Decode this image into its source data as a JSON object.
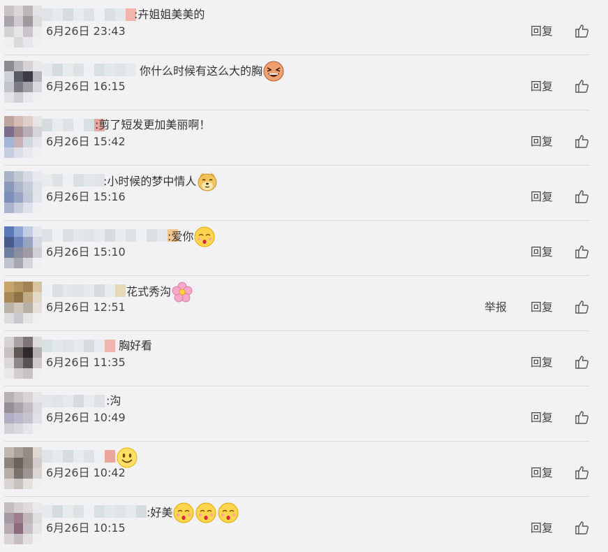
{
  "actions": {
    "reply_label": "回复",
    "report_label": "举报"
  },
  "comments": [
    {
      "prefix": ": ",
      "text": "卉姐姐美美的",
      "time": "6月26日 23:43",
      "emojis": []
    },
    {
      "prefix": "",
      "text": "你什么时候有这么大的胸",
      "time": "6月26日 16:15",
      "emojis": [
        "laughing-face-emoji"
      ]
    },
    {
      "prefix": ": ",
      "text": "剪了短发更加美丽啊！",
      "time": "6月26日 15:42",
      "emojis": []
    },
    {
      "prefix": ": ",
      "text": "小时候的梦中情人",
      "time": "6月26日 15:16",
      "emojis": [
        "doge-emoji"
      ]
    },
    {
      "prefix": ": ",
      "text": "爱你",
      "time": "6月26日 15:10",
      "emojis": [
        "kissing-face-emoji"
      ]
    },
    {
      "prefix": "",
      "text": "花式秀沟",
      "time": "6月26日 12:51",
      "emojis": [
        "flower-emoji"
      ],
      "report": true
    },
    {
      "prefix": "",
      "text": "胸好看",
      "time": "6月26日 11:35",
      "emojis": []
    },
    {
      "prefix": ": ",
      "text": "沟",
      "time": "6月26日 10:49",
      "emojis": []
    },
    {
      "prefix": "",
      "text": "",
      "time": "6月26日 10:42",
      "emojis": [
        "smiling-face-emoji"
      ]
    },
    {
      "prefix": ": ",
      "text": "好美",
      "time": "6月26日 10:15",
      "emojis": [
        "kissing-face-emoji",
        "kissing-face-emoji",
        "kissing-face-emoji"
      ]
    }
  ]
}
